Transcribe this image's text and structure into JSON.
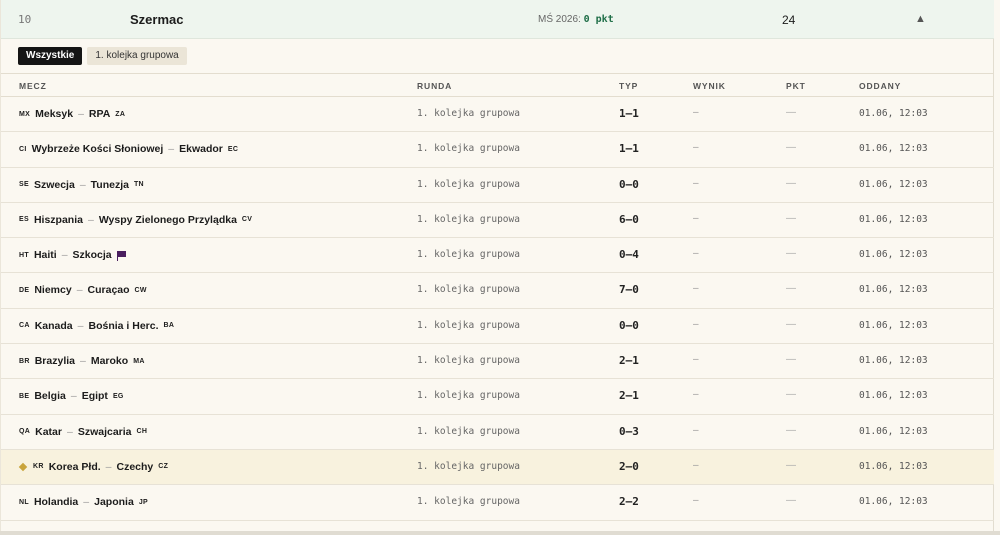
{
  "player": {
    "rank": "10",
    "name": "Szermac",
    "tournament_label": "MŚ 2026:",
    "tournament_points": "0 pkt",
    "total": "24",
    "collapse_glyph": "▲"
  },
  "filters": [
    {
      "label": "Wszystkie",
      "active": true
    },
    {
      "label": "1. kolejka grupowa",
      "active": false
    }
  ],
  "columns": {
    "match": "MECZ",
    "round": "RUNDA",
    "typ": "TYP",
    "result": "WYNIK",
    "points": "PKT",
    "submitted": "ODDANY"
  },
  "icons": {
    "highlight": "star-icon",
    "scotland_flag": "flag-icon",
    "collapse": "chevron-up-icon"
  },
  "colors": {
    "header_bg": "#eef5ee",
    "points_green": "#1f6e47",
    "highlight_row": "#f8f2de",
    "star": "#c9a43b"
  },
  "rows": [
    {
      "home_code": "MX",
      "home": "Meksyk",
      "away": "RPA",
      "away_code": "ZA",
      "round": "1. kolejka grupowa",
      "typ": "1–1",
      "result": "–",
      "points": "—",
      "submitted": "01.06, 12:03"
    },
    {
      "home_code": "CI",
      "home": "Wybrzeże Kości Słoniowej",
      "away": "Ekwador",
      "away_code": "EC",
      "round": "1. kolejka grupowa",
      "typ": "1–1",
      "result": "–",
      "points": "—",
      "submitted": "01.06, 12:03"
    },
    {
      "home_code": "SE",
      "home": "Szwecja",
      "away": "Tunezja",
      "away_code": "TN",
      "round": "1. kolejka grupowa",
      "typ": "0–0",
      "result": "–",
      "points": "—",
      "submitted": "01.06, 12:03"
    },
    {
      "home_code": "ES",
      "home": "Hiszpania",
      "away": "Wyspy Zielonego Przylądka",
      "away_code": "CV",
      "round": "1. kolejka grupowa",
      "typ": "6–0",
      "result": "–",
      "points": "—",
      "submitted": "01.06, 12:03"
    },
    {
      "home_code": "HT",
      "home": "Haiti",
      "away": "Szkocja",
      "away_code": "",
      "away_flag": true,
      "round": "1. kolejka grupowa",
      "typ": "0–4",
      "result": "–",
      "points": "—",
      "submitted": "01.06, 12:03"
    },
    {
      "home_code": "DE",
      "home": "Niemcy",
      "away": "Curaçao",
      "away_code": "CW",
      "round": "1. kolejka grupowa",
      "typ": "7–0",
      "result": "–",
      "points": "—",
      "submitted": "01.06, 12:03"
    },
    {
      "home_code": "CA",
      "home": "Kanada",
      "away": "Bośnia i Herc.",
      "away_code": "BA",
      "round": "1. kolejka grupowa",
      "typ": "0–0",
      "result": "–",
      "points": "—",
      "submitted": "01.06, 12:03"
    },
    {
      "home_code": "BR",
      "home": "Brazylia",
      "away": "Maroko",
      "away_code": "MA",
      "round": "1. kolejka grupowa",
      "typ": "2–1",
      "result": "–",
      "points": "—",
      "submitted": "01.06, 12:03"
    },
    {
      "home_code": "BE",
      "home": "Belgia",
      "away": "Egipt",
      "away_code": "EG",
      "round": "1. kolejka grupowa",
      "typ": "2–1",
      "result": "–",
      "points": "—",
      "submitted": "01.06, 12:03"
    },
    {
      "home_code": "QA",
      "home": "Katar",
      "away": "Szwajcaria",
      "away_code": "CH",
      "round": "1. kolejka grupowa",
      "typ": "0–3",
      "result": "–",
      "points": "—",
      "submitted": "01.06, 12:03"
    },
    {
      "home_code": "KR",
      "home": "Korea Płd.",
      "away": "Czechy",
      "away_code": "CZ",
      "round": "1. kolejka grupowa",
      "typ": "2–0",
      "result": "–",
      "points": "—",
      "submitted": "01.06, 12:03",
      "highlight": true
    },
    {
      "home_code": "NL",
      "home": "Holandia",
      "away": "Japonia",
      "away_code": "JP",
      "round": "1. kolejka grupowa",
      "typ": "2–2",
      "result": "–",
      "points": "—",
      "submitted": "01.06, 12:03"
    }
  ]
}
